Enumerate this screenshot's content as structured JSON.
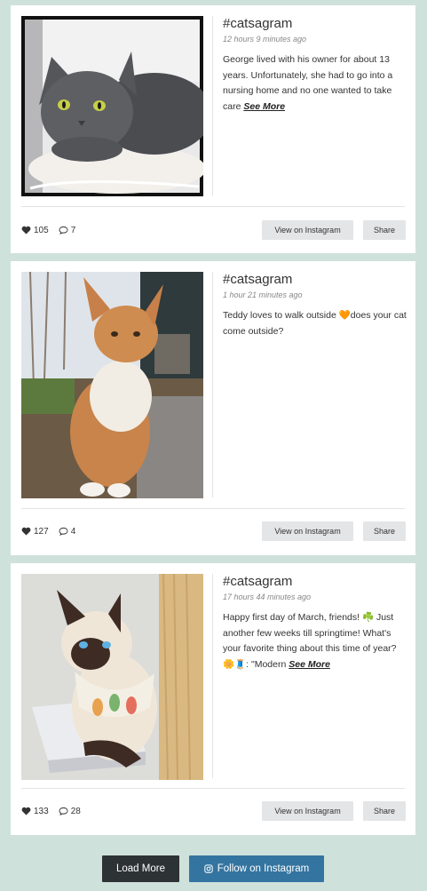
{
  "posts": [
    {
      "hashtag": "#catsagram",
      "time": "12 hours 9 minutes ago",
      "caption": "George lived with his owner for about 13 years. Unfortunately, she had to go into a nursing home and no one wanted to take care",
      "see_more": "See More",
      "likes": "105",
      "comments": "7",
      "view_label": "View on Instagram",
      "share_label": "Share"
    },
    {
      "hashtag": "#catsagram",
      "time": "1 hour 21 minutes ago",
      "caption": "Teddy loves to walk outside 🧡does your cat come outside?",
      "likes": "127",
      "comments": "4",
      "view_label": "View on Instagram",
      "share_label": "Share"
    },
    {
      "hashtag": "#catsagram",
      "time": "17 hours 44 minutes ago",
      "caption": "Happy first day of March, friends! ☘️ Just another few weeks till springtime! What's your favorite thing about this time of year? 🌼🧵: \"Modern",
      "see_more": "See More",
      "likes": "133",
      "comments": "28",
      "view_label": "View on Instagram",
      "share_label": "Share"
    }
  ],
  "footer": {
    "load_more": "Load More",
    "follow": "Follow on Instagram"
  },
  "icons": {
    "likes": "heart-icon",
    "comments": "speech-bubble-icon",
    "follow": "instagram-icon"
  },
  "colors": {
    "background": "#cfe1db",
    "load_more_bg": "#2d3234",
    "follow_bg": "#3474a0"
  }
}
